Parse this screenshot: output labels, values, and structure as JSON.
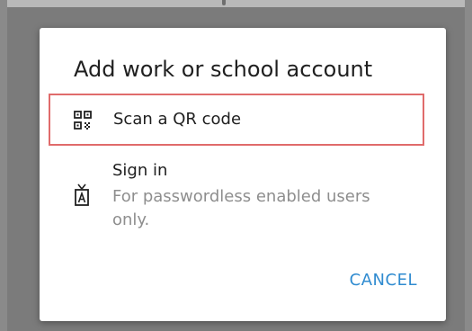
{
  "dialog": {
    "title": "Add work or school account",
    "options": [
      {
        "icon": "qr-code-icon",
        "label": "Scan a QR code"
      },
      {
        "icon": "passwordless-signin-icon",
        "label": "Sign in",
        "description": "For passwordless enabled users only."
      }
    ],
    "cancel_label": "CANCEL"
  },
  "colors": {
    "accent": "#2f8bd0",
    "highlight_border": "#e06b6b",
    "backdrop": "#7b7b7b",
    "secondary_text": "#8e8e8e"
  }
}
